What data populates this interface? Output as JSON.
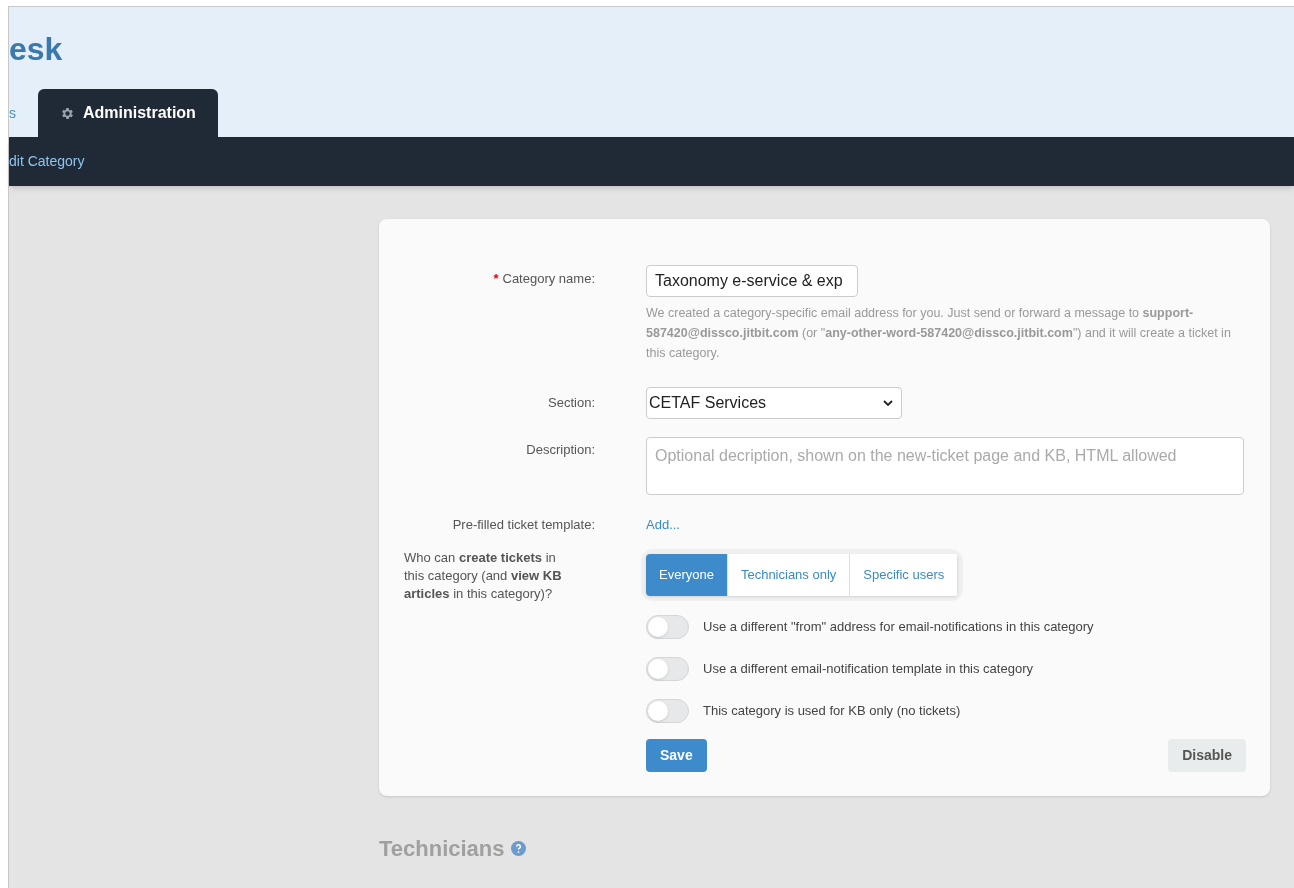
{
  "header": {
    "title": "esk"
  },
  "tabs": [
    {
      "label": "s",
      "selected": false
    },
    {
      "label": "Administration",
      "selected": true
    }
  ],
  "breadcrumb": "dit Category",
  "form": {
    "category_name": {
      "label": "Category name:",
      "required_mark": "*",
      "value": "Taxonomy e-service & exp",
      "hint": "We created a category-specific email address for you. Just send or forward a message to **support-587420@dissco.jitbit.com** (or \"**any-other-word-587420@dissco.jitbit.com**\") and it will create a ticket in this category."
    },
    "section": {
      "label": "Section:",
      "value": "CETAF Services"
    },
    "description": {
      "label": "Description:",
      "placeholder": "Optional decription, shown on the new-ticket page and KB, HTML allowed"
    },
    "template": {
      "label": "Pre-filled ticket template:",
      "link": "Add..."
    },
    "access": {
      "label": "Who can **create tickets** in this category (and **view KB articles** in this category)?",
      "options": [
        {
          "label": "Everyone",
          "selected": true
        },
        {
          "label": "Technicians only",
          "selected": false
        },
        {
          "label": "Specific users",
          "selected": false
        }
      ]
    },
    "toggles": [
      {
        "label": "Use a different \"from\" address for email-notifications in this category",
        "on": false
      },
      {
        "label": "Use a different email-notification template in this category",
        "on": false
      },
      {
        "label": "This category is used for KB only (no tickets)",
        "on": false
      }
    ],
    "buttons": {
      "save": "Save",
      "disable": "Disable"
    }
  },
  "technicians": {
    "title": "Technicians"
  }
}
